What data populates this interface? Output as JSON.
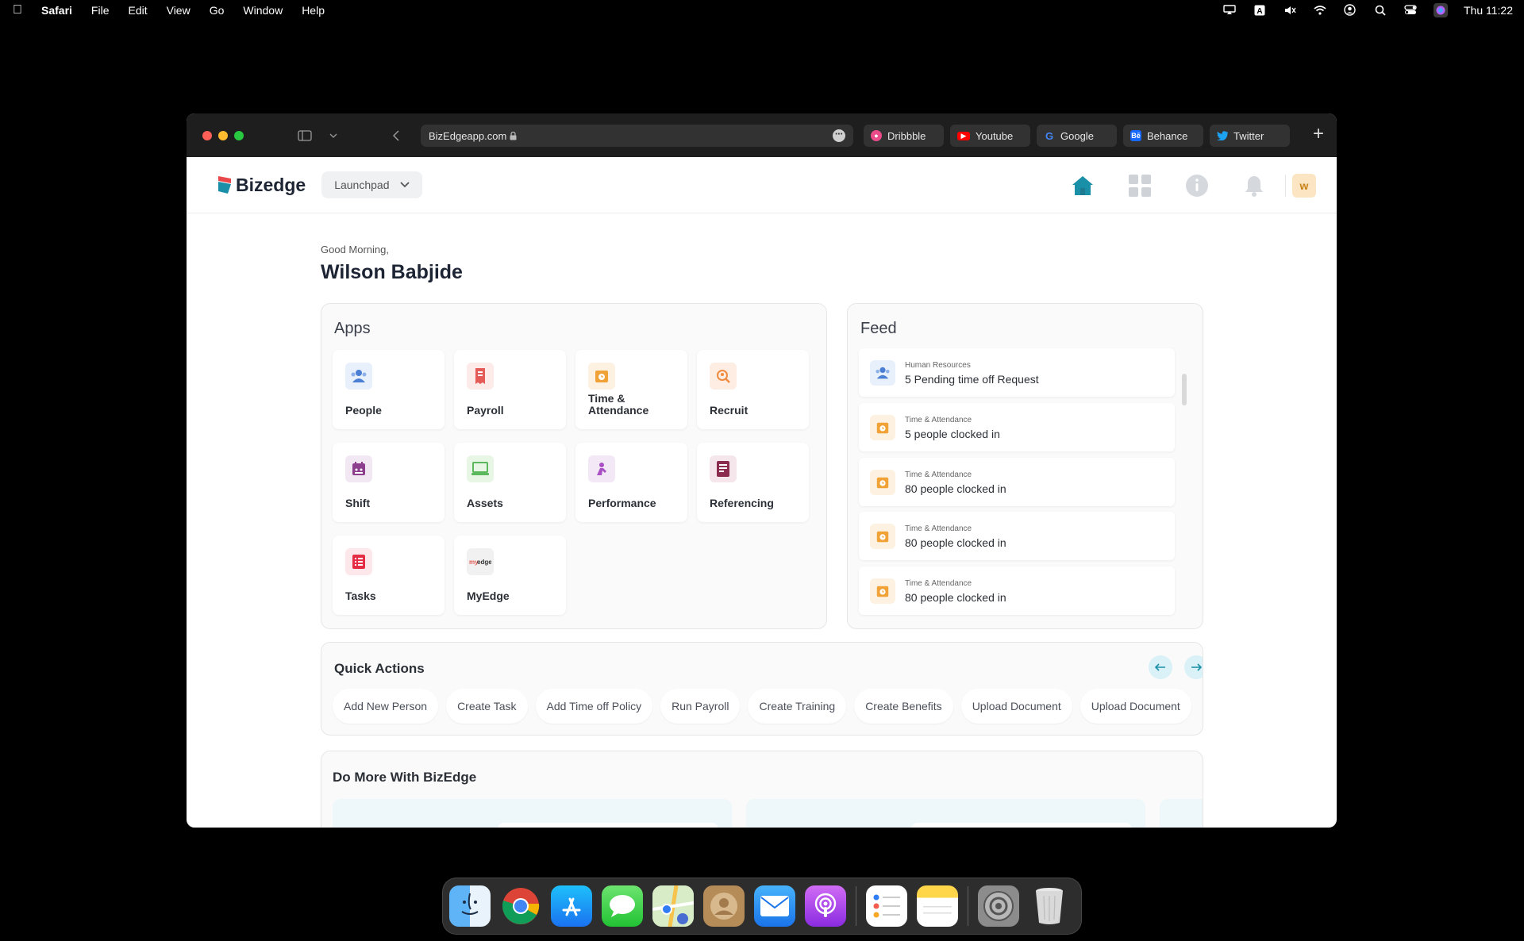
{
  "menubar": {
    "items": [
      "Safari",
      "File",
      "Edit",
      "View",
      "Go",
      "Window",
      "Help"
    ],
    "clock": "Thu 11:22"
  },
  "browser": {
    "url": "BizEdgeapp.com",
    "favorites": [
      {
        "label": "Dribbble",
        "icon": "dribbble-icon",
        "color": "#ea4c89"
      },
      {
        "label": "Youtube",
        "icon": "youtube-icon",
        "color": "#ff0000"
      },
      {
        "label": "Google",
        "icon": "google-icon",
        "color": "#4285f4"
      },
      {
        "label": "Behance",
        "icon": "behance-icon",
        "color": "#1769ff"
      },
      {
        "label": "Twitter",
        "icon": "twitter-icon",
        "color": "#1da1f2"
      }
    ]
  },
  "header": {
    "brand": "Bizedge",
    "launchpad_label": "Launchpad",
    "avatar_initial": "w",
    "accent": "#1a8fa8"
  },
  "greeting": {
    "salutation": "Good Morning,",
    "name": "Wilson Babjide"
  },
  "apps": {
    "title": "Apps",
    "items": [
      {
        "label": "People",
        "icon": "people-icon",
        "bg": "#e7f0fb",
        "fg": "#4a7fd4"
      },
      {
        "label": "Payroll",
        "icon": "payroll-icon",
        "bg": "#fdebea",
        "fg": "#e45b57"
      },
      {
        "label": "Time & Attendance",
        "icon": "clock-icon",
        "bg": "#fdf1e1",
        "fg": "#f0a236"
      },
      {
        "label": "Recruit",
        "icon": "search-icon",
        "bg": "#fdede3",
        "fg": "#ef8b3f"
      },
      {
        "label": "Shift",
        "icon": "calendar-icon",
        "bg": "#f1e8f3",
        "fg": "#8e3e8f"
      },
      {
        "label": "Assets",
        "icon": "laptop-icon",
        "bg": "#e8f6e6",
        "fg": "#5cb85c"
      },
      {
        "label": "Performance",
        "icon": "performance-icon",
        "bg": "#f3e8f6",
        "fg": "#a950c4"
      },
      {
        "label": "Referencing",
        "icon": "document-icon",
        "bg": "#f5e6ec",
        "fg": "#8b2c4f"
      },
      {
        "label": "Tasks",
        "icon": "tasks-icon",
        "bg": "#fde7ea",
        "fg": "#e52e46"
      },
      {
        "label": "MyEdge",
        "icon": "myedge-icon",
        "bg": "#f1f1f1",
        "fg": "#333333"
      }
    ]
  },
  "feed": {
    "title": "Feed",
    "items": [
      {
        "category": "Human Resources",
        "text": "5 Pending time off Request",
        "icon": "people-icon",
        "bg": "#e7f0fb",
        "fg": "#4a7fd4"
      },
      {
        "category": "Time & Attendance",
        "text": "5 people clocked in",
        "icon": "clock-icon",
        "bg": "#fdf1e1",
        "fg": "#f0a236"
      },
      {
        "category": "Time & Attendance",
        "text": "80 people clocked in",
        "icon": "clock-icon",
        "bg": "#fdf1e1",
        "fg": "#f0a236"
      },
      {
        "category": "Time & Attendance",
        "text": "80 people clocked in",
        "icon": "clock-icon",
        "bg": "#fdf1e1",
        "fg": "#f0a236"
      },
      {
        "category": "Time & Attendance",
        "text": "80 people clocked in",
        "icon": "clock-icon",
        "bg": "#fdf1e1",
        "fg": "#f0a236"
      }
    ]
  },
  "quick_actions": {
    "title": "Quick Actions",
    "items": [
      "Add New Person",
      "Create Task",
      "Add Time off Policy",
      "Run Payroll",
      "Create Training",
      "Create Benefits",
      "Upload Document",
      "Upload Document"
    ]
  },
  "do_more": {
    "title": "Do More With BizEdge"
  },
  "dock": {
    "apps": [
      {
        "icon": "finder-icon",
        "color": "#3b9cf4"
      },
      {
        "icon": "chrome-icon",
        "color": "#ffffff"
      },
      {
        "icon": "app-store-icon",
        "color": "#1a8cf0"
      },
      {
        "icon": "messages-icon",
        "color": "#36d056"
      },
      {
        "icon": "maps-icon",
        "color": "#7fd37a"
      },
      {
        "icon": "contacts-icon",
        "color": "#b58b57"
      },
      {
        "icon": "mail-icon",
        "color": "#2d8ff4"
      },
      {
        "icon": "podcasts-icon",
        "color": "#a94ee0"
      },
      {
        "icon": "reminders-icon",
        "color": "#ffffff"
      },
      {
        "icon": "notes-icon",
        "color": "#ffd54a"
      },
      {
        "icon": "system-settings-icon",
        "color": "#8c8c8c"
      },
      {
        "icon": "trash-icon",
        "color": "#d9d9d9"
      }
    ]
  }
}
